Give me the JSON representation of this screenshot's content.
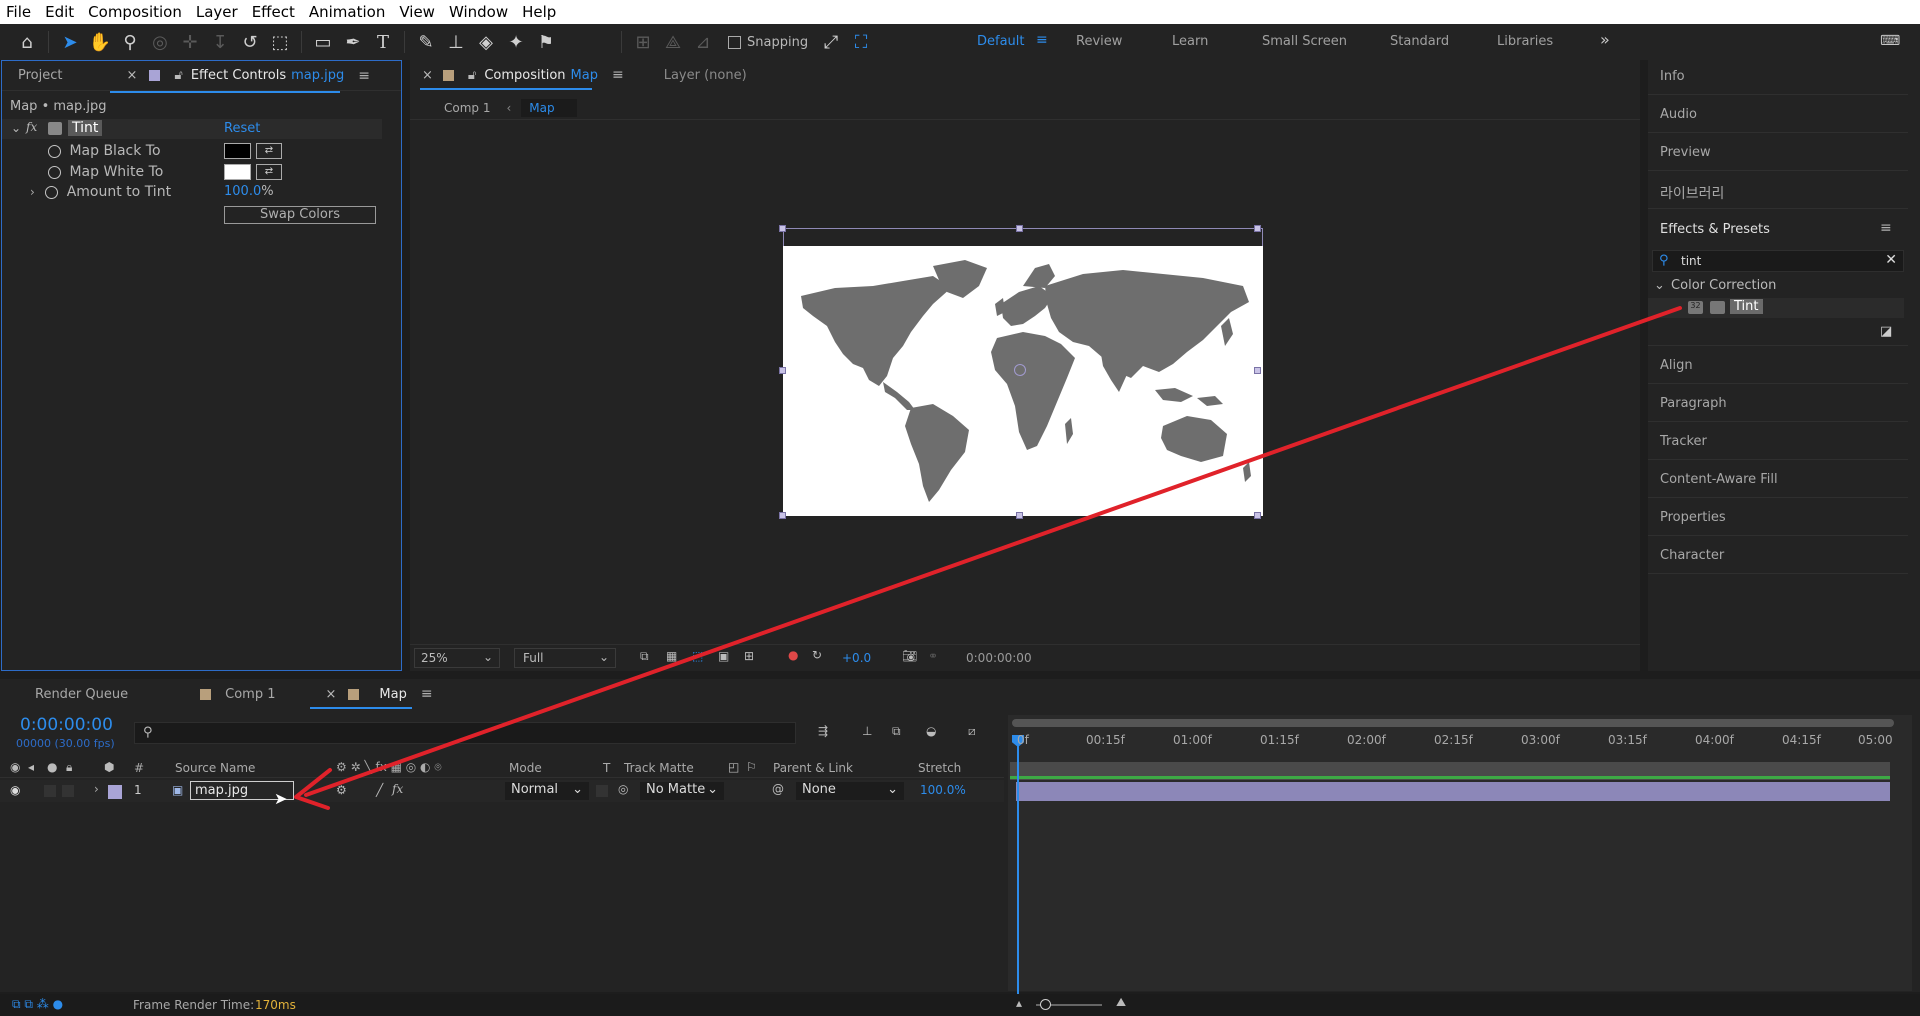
{
  "menu": [
    "File",
    "Edit",
    "Composition",
    "Layer",
    "Effect",
    "Animation",
    "View",
    "Window",
    "Help"
  ],
  "toolbar": {
    "snapping_label": "Snapping",
    "workspaces": [
      "Default",
      "Review",
      "Learn",
      "Small Screen",
      "Standard",
      "Libraries"
    ],
    "active_workspace": "Default",
    "overflow": "»"
  },
  "effect_controls": {
    "tab_project": "Project",
    "tab_label": "Effect Controls",
    "tab_file": "map.jpg",
    "breadcrumb": "Map • map.jpg",
    "effect_name": "Tint",
    "reset_label": "Reset",
    "properties": [
      {
        "name": "Map Black To",
        "value_color": "#000000"
      },
      {
        "name": "Map White To",
        "value_color": "#ffffff"
      },
      {
        "name": "Amount to Tint",
        "value": "100.0",
        "unit": "%"
      }
    ],
    "swap_button": "Swap Colors"
  },
  "composition": {
    "tab_label": "Composition",
    "tab_name": "Map",
    "layer_tab": "Layer (none)",
    "crumbs": [
      "Comp 1",
      "Map"
    ],
    "zoom": "25%",
    "resolution": "Full",
    "exposure": "+0.0",
    "timecode": "0:00:00:00"
  },
  "right_panel": {
    "items_top": [
      "Info",
      "Audio",
      "Preview",
      "라이브러리"
    ],
    "effects_presets_title": "Effects & Presets",
    "search_value": "tint",
    "category": "Color Correction",
    "result": "Tint",
    "items_bottom": [
      "Align",
      "Paragraph",
      "Tracker",
      "Content-Aware Fill",
      "Properties",
      "Character"
    ]
  },
  "timeline": {
    "tabs": [
      "Render Queue",
      "Comp 1",
      "Map"
    ],
    "timecode": "0:00:00:00",
    "frames": "00000 (30.00 fps)",
    "columns": {
      "hash": "#",
      "source": "Source Name",
      "mode": "Mode",
      "t": "T",
      "track_matte": "Track Matte",
      "parent": "Parent & Link",
      "stretch": "Stretch"
    },
    "layer": {
      "index": "1",
      "name": "map.jpg",
      "mode": "Normal",
      "track_matte": "No Matte",
      "parent": "None",
      "stretch": "100.0%"
    },
    "ruler": [
      "0f",
      "00:15f",
      "01:00f",
      "01:15f",
      "02:00f",
      "02:15f",
      "03:00f",
      "03:15f",
      "04:00f",
      "04:15f",
      "05:00"
    ]
  },
  "status": {
    "label": "Frame Render Time:",
    "value": "170ms"
  },
  "colors": {
    "accent": "#2d8ceb",
    "annotation_arrow": "#e0222a",
    "layer_label": "#a9a4d6",
    "work_area": "#3da945",
    "layer_bar": "#8c87b8"
  }
}
